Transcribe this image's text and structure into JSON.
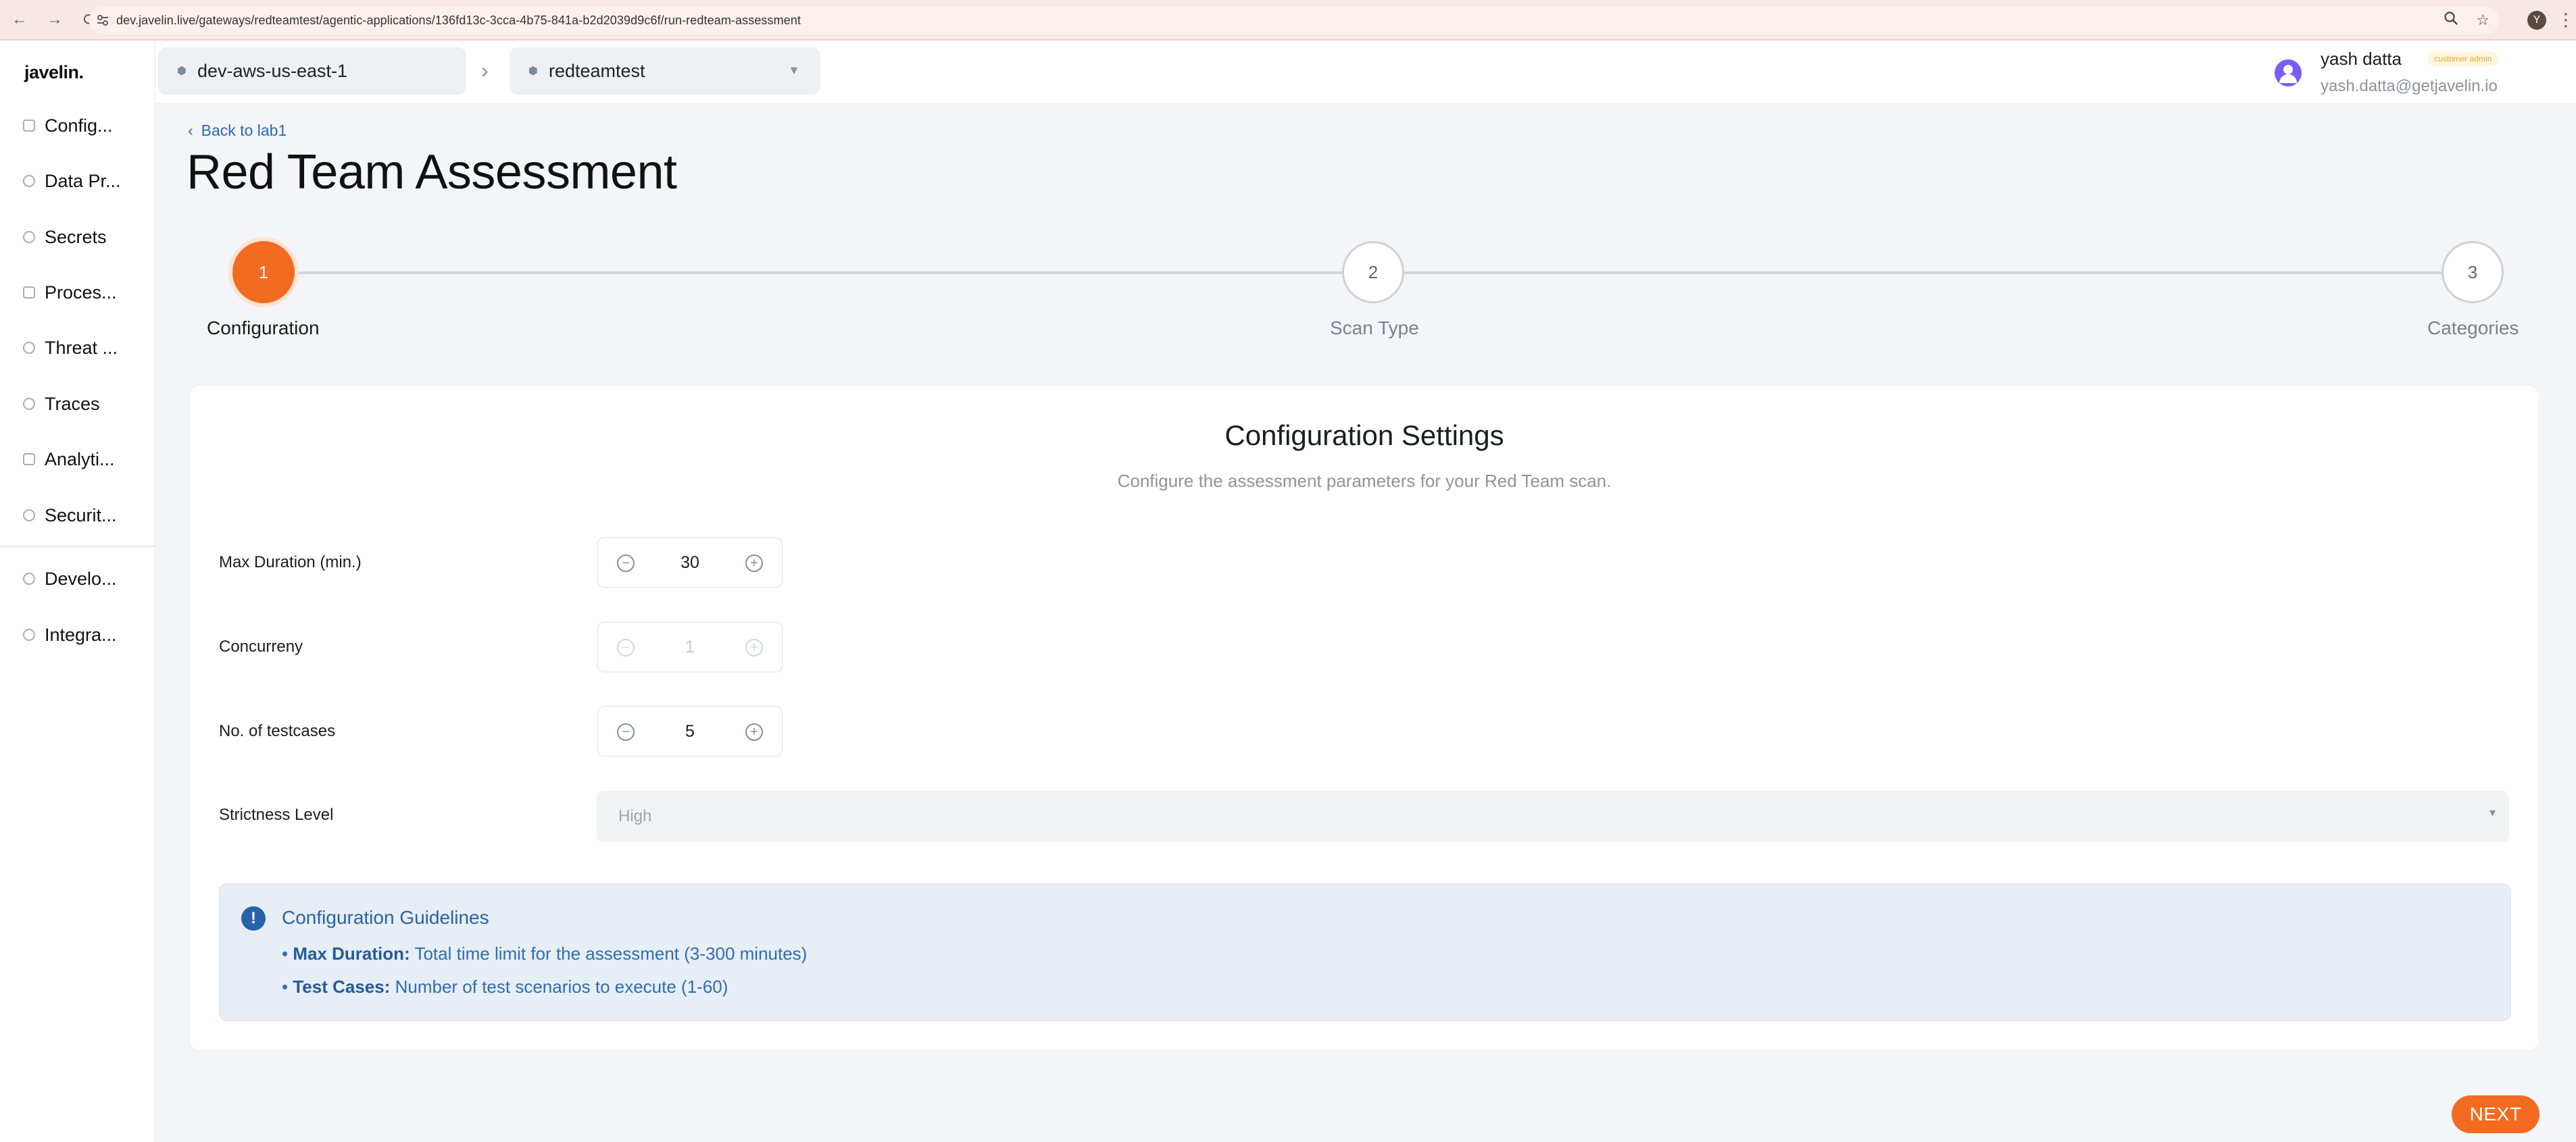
{
  "browser": {
    "back_icon": "←",
    "forward_icon": "→",
    "reload_icon": "⟳",
    "url": "dev.javelin.live/gateways/redteamtest/agentic-applications/136fd13c-3cca-4b75-841a-b2d2039d9c6f/run-redteam-assessment",
    "profile_initial": "Y"
  },
  "sidebar": {
    "logo": "javelin.",
    "items": [
      {
        "label": "Config..."
      },
      {
        "label": "Data Pr..."
      },
      {
        "label": "Secrets"
      },
      {
        "label": "Proces..."
      },
      {
        "label": "Threat ..."
      },
      {
        "label": "Traces"
      },
      {
        "label": "Analyti..."
      },
      {
        "label": "Securit..."
      },
      {
        "label": "Develo..."
      },
      {
        "label": "Integra..."
      }
    ]
  },
  "header": {
    "gateway": "dev-aws-us-east-1",
    "separator": "›",
    "app": "redteamtest",
    "user_name": "yash datta",
    "user_badge": "customer admin",
    "user_email": "yash.datta@getjavelin.io"
  },
  "main": {
    "back_link": "Back to lab1",
    "title": "Red Team Assessment",
    "steps": [
      {
        "number": "1",
        "label": "Configuration",
        "state": "active"
      },
      {
        "number": "2",
        "label": "Scan Type",
        "state": "inactive"
      },
      {
        "number": "3",
        "label": "Categories",
        "state": "inactive"
      }
    ],
    "card": {
      "title": "Configuration Settings",
      "subtitle": "Configure the assessment parameters for your Red Team scan.",
      "fields": {
        "max_duration": {
          "label": "Max Duration (min.)",
          "value": "30"
        },
        "concurrency": {
          "label": "Concurreny",
          "value": "1"
        },
        "testcases": {
          "label": "No. of testcases",
          "value": "5"
        },
        "strictness": {
          "label": "Strictness Level",
          "value": "High"
        }
      },
      "guidelines": {
        "title": "Configuration Guidelines",
        "items": [
          {
            "bullet": "•",
            "key": "Max Duration:",
            "text": "Total time limit for the assessment (3-300 minutes)"
          },
          {
            "bullet": "•",
            "key": "Test Cases:",
            "text": "Number of test scenarios to execute (1-60)"
          }
        ]
      }
    },
    "next_label": "NEXT"
  },
  "colors": {
    "accent": "#f26b21",
    "link": "#2a6ab0",
    "info_bg": "#e7eef5",
    "info_text": "#2e6db3"
  }
}
